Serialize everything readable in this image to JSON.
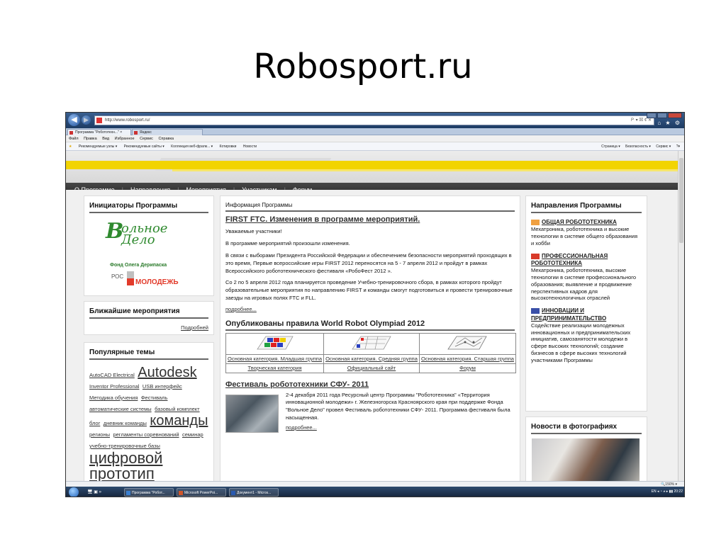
{
  "slide": {
    "title": "Robosport.ru"
  },
  "browser": {
    "address": "http://www.robosport.ru/",
    "address_controls": "Ｐ ▾ ⊠ ¢ ✕",
    "toolbar_icons": "⌂ ★ ⚙",
    "tabs": [
      {
        "label": "Программа \"Робототехн...\" ×"
      },
      {
        "label": "Яндекс"
      }
    ],
    "menu": [
      "Файл",
      "Правка",
      "Вид",
      "Избранное",
      "Сервис",
      "Справка"
    ],
    "favorites": [
      "Рекомендуемые узлы ▾",
      "Рекомендуемые сайты ▾",
      "Коллекция веб-фрагм... ▾",
      "Котировки",
      "Новости"
    ],
    "commands": [
      "Страница ▾",
      "Безопасность ▾",
      "Сервис ▾",
      "?▾"
    ],
    "zoom": "🔍150% ▾"
  },
  "site": {
    "nav": [
      "О Программе",
      "Направления",
      "Мероприятия",
      "Участникам",
      "Форум"
    ],
    "initiators": {
      "title": "Инициаторы Программы",
      "logo_letter": "В",
      "logo_text": "ольное\nДело",
      "logo_sub": "Фонд Олега Дерипаска",
      "ros_top": "РОС",
      "ros_bottom": "МОЛОДЕЖЬ"
    },
    "events": {
      "title": "Ближайшие мероприятия",
      "more": "Подробней"
    },
    "popular": {
      "title": "Популярные темы",
      "tags": [
        {
          "text": "AutoCAD Electrical",
          "size": "s"
        },
        {
          "text": "Autodesk",
          "size": "l"
        },
        {
          "text": "Inventor Professional",
          "size": "s"
        },
        {
          "text": "USB интерфейс",
          "size": "s"
        },
        {
          "text": "Методика обучения",
          "size": "s"
        },
        {
          "text": "Фестиваль",
          "size": "s"
        },
        {
          "text": "автоматические системы",
          "size": "s"
        },
        {
          "text": "базовый комплект",
          "size": "s"
        },
        {
          "text": "блог",
          "size": "s"
        },
        {
          "text": "дневник команды",
          "size": "s"
        },
        {
          "text": "команды",
          "size": "l"
        },
        {
          "text": "регионы",
          "size": "s"
        },
        {
          "text": "регламенты соревнований",
          "size": "s"
        },
        {
          "text": "семинар",
          "size": "s"
        },
        {
          "text": "учебно-тренировочные базы",
          "size": "s"
        },
        {
          "text": "цифровой прототип",
          "size": "xl"
        }
      ]
    },
    "center": {
      "header": "Информация Программы",
      "article_title": "FIRST FTC. Изменения в программе мероприятий.",
      "paragraphs": [
        "Уважаемые участники!",
        "В программе мероприятий произошли изменения.",
        "В связи с выборами Президента Российской Федерации и обеспечением безопасности мероприятий проходящих в это время, Первые всероссийские игры FIRST 2012 переносятся на 5 - 7 апреля 2012 и пройдут в рамках Всероссийского робототехнического фестиваля «РобоФест 2012 ».",
        "Со 2 по 5 апреля 2012 года планируется проведение Учебно-тренировочного сбора, в рамках которого пройдут образовательные мероприятия по направлению FIRST и команды смогут подготовиться и провести тренировочные заезды на игровых полях FTC и FLL."
      ],
      "more": "подробнее...",
      "wro_title": "Опубликованы правила World Robot Olympiad 2012",
      "wro_links": [
        "Основная категория. Младшая группа",
        "Основная категория. Средняя группа",
        "Основная категория. Старшая группа"
      ],
      "wro_bottom": [
        "Творческая категория",
        "Официальный сайт",
        "Форум"
      ],
      "fest_title": "Фестиваль робототехники СФУ- 2011",
      "fest_text": "2-4 декабря 2011 года Ресурсный центр Программы \"Робототехника\" «Территория инновационной молодежи» г. Железногорска Красноярского края при поддержке Фонда \"Вольное Дело\" провел Фестиваль робототехники СФУ- 2011. Программа фестиваля была насыщенная.",
      "fest_more": "подробнее..."
    },
    "directions": {
      "title": "Направления Программы",
      "items": [
        {
          "head": "ОБЩАЯ РОБОТОТЕХНИКА",
          "text": "Мехатроника, робототехника и высокие технологии в системе общего образования и хобби",
          "color": "#f0a040"
        },
        {
          "head": "ПРОФЕССИОНАЛЬНАЯ РОБОТОТЕХНИКА",
          "text": "Мехатроника, робототехника, высокие технологии в системе профессионального образования; выявление и продвижение перспективных кадров для высокотехнологичных отраслей",
          "color": "#d83a2a"
        },
        {
          "head": "ИННОВАЦИИ И ПРЕДПРИНИМАТЕЛЬСТВО",
          "text": "Содействие реализации молодежных инновационных и предпринимательских инициатив, самозанятости молодежи в сфере высоких технологий; создание бизнесов в сфере высоких технологий участниками Программы",
          "color": "#3a4fa8"
        }
      ]
    },
    "news": {
      "title": "Новости в фотографиях"
    }
  },
  "taskbar": {
    "quick": "🖥 ▣  »",
    "buttons": [
      {
        "label": "Программа \"Робот...",
        "color": "#3a7fd0"
      },
      {
        "label": "Microsoft PowerPoi...",
        "color": "#d0562a"
      },
      {
        "label": "Документ1 - Micros...",
        "color": "#2a5ab0"
      }
    ],
    "tray": "EN  ◂ ◔ ◕ ▸ ▮▮ 20:22"
  }
}
